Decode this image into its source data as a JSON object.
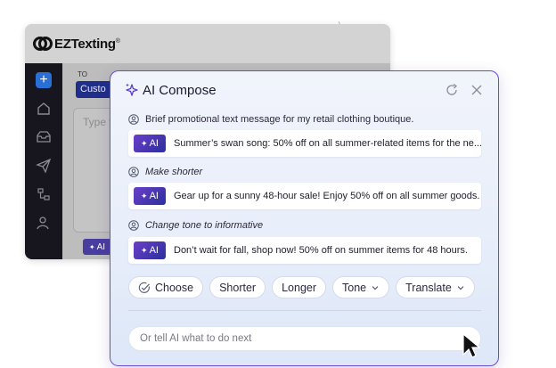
{
  "app": {
    "logo_text": "EZTexting",
    "logo_mark": "®",
    "to_label": "TO",
    "recipient_chip": "Custo",
    "message_placeholder": "Type y",
    "ai_button_label": "AI"
  },
  "panel": {
    "title": "AI Compose",
    "icons": {
      "header": "sparkle-icon",
      "refresh": "refresh-icon",
      "close": "close-icon",
      "user": "user-icon"
    },
    "ai_badge_label": "AI",
    "conversation": [
      {
        "prompt": "Brief promotional text message for my retail clothing boutique.",
        "prompt_italic": false,
        "response": "Summer’s swan song: 50% off on all summer-related items for the ne..."
      },
      {
        "prompt": "Make shorter",
        "prompt_italic": true,
        "response": "Gear up for a sunny 48-hour sale! Enjoy 50% off on all summer goods."
      },
      {
        "prompt": "Change tone to informative",
        "prompt_italic": true,
        "response": "Don’t wait for fall, shop now! 50% off on summer items for 48 hours."
      }
    ],
    "actions": {
      "choose": "Choose",
      "shorter": "Shorter",
      "longer": "Longer",
      "tone": "Tone",
      "translate": "Translate"
    },
    "input_placeholder": "Or tell AI what to do next"
  },
  "colors": {
    "accent": "#6a4bd6",
    "badge_start": "#6a3fc8",
    "badge_end": "#2c2f9e",
    "sidebar": "#17161e",
    "recipient_chip": "#1f2e8a"
  }
}
